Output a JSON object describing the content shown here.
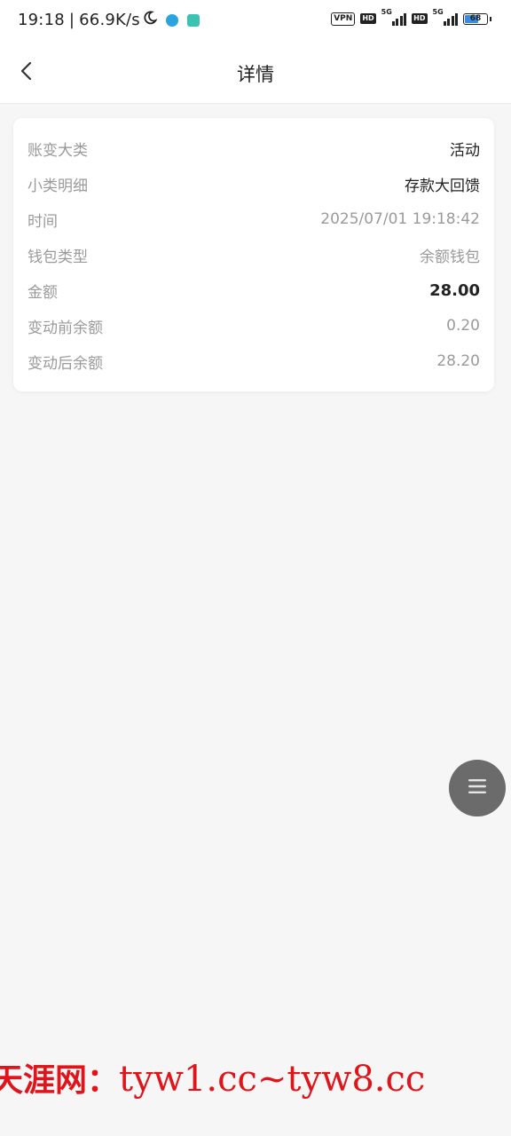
{
  "status_bar": {
    "time": "19:18",
    "separator": "|",
    "net_speed": "66.9K/s",
    "vpn": "VPN",
    "hd1": "HD",
    "net1": "5G",
    "hd2": "HD",
    "net2": "5G",
    "battery": "68",
    "icons": [
      "moon-icon",
      "telegram-icon",
      "app-shield-icon",
      "signal-icon",
      "battery-icon"
    ]
  },
  "nav": {
    "back_icon": "chevron-left-icon",
    "title": "详情"
  },
  "detail": {
    "rows": [
      {
        "label": "账变大类",
        "value": "活动"
      },
      {
        "label": "小类明细",
        "value": "存款大回馈"
      },
      {
        "label": "时间",
        "value": "2025/07/01 19:18:42"
      },
      {
        "label": "钱包类型",
        "value": "余额钱包"
      },
      {
        "label": "金额",
        "value": "28.00"
      },
      {
        "label": "变动前余额",
        "value": "0.20"
      },
      {
        "label": "变动后余额",
        "value": "28.20"
      }
    ]
  },
  "float_button": {
    "icon": "menu-icon"
  },
  "watermark": {
    "cn": "天涯网：",
    "en": "tyw1.cc~tyw8.cc",
    "color": "#e0141b"
  },
  "colors": {
    "background": "#f6f6f6",
    "card": "#ffffff",
    "label": "#9a9a9a",
    "value_dark": "#222222",
    "float_button": "#6b6b6b"
  }
}
